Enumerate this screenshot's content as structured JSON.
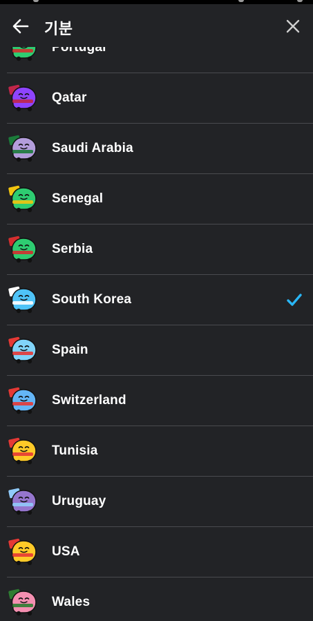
{
  "header": {
    "title": "기분",
    "back_icon": "arrow-left-icon",
    "close_icon": "close-icon"
  },
  "moods": [
    {
      "name": "Portugal",
      "body": "#2ecc71",
      "accent": "#d32f2f",
      "selected": false
    },
    {
      "name": "Qatar",
      "body": "#8e44ff",
      "accent": "#c0264a",
      "selected": false
    },
    {
      "name": "Saudi Arabia",
      "body": "#b39ddb",
      "accent": "#1b7a3a",
      "selected": false
    },
    {
      "name": "Senegal",
      "body": "#2ecc71",
      "accent": "#f1c40f",
      "selected": false
    },
    {
      "name": "Serbia",
      "body": "#2ecc71",
      "accent": "#d32f2f",
      "selected": false
    },
    {
      "name": "South Korea",
      "body": "#4fc3f7",
      "accent": "#ffffff",
      "selected": true
    },
    {
      "name": "Spain",
      "body": "#81d4fa",
      "accent": "#e53935",
      "selected": false
    },
    {
      "name": "Switzerland",
      "body": "#64b5f6",
      "accent": "#e53935",
      "selected": false
    },
    {
      "name": "Tunisia",
      "body": "#ffca28",
      "accent": "#e53935",
      "selected": false
    },
    {
      "name": "Uruguay",
      "body": "#9575cd",
      "accent": "#90caf9",
      "selected": false
    },
    {
      "name": "USA",
      "body": "#ffca28",
      "accent": "#e53935",
      "selected": false
    },
    {
      "name": "Wales",
      "body": "#f48fb1",
      "accent": "#2e7d32",
      "selected": false
    }
  ],
  "colors": {
    "background": "#222326",
    "divider": "#4a4b4f",
    "check": "#29b6f6"
  }
}
